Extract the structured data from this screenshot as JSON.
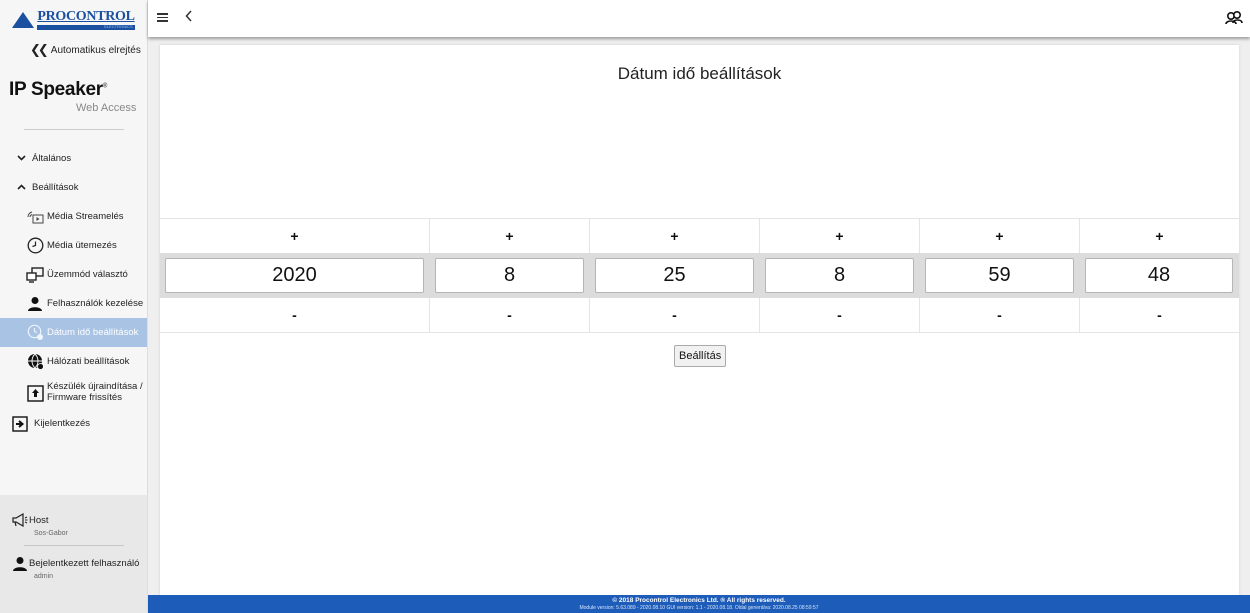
{
  "logo": {
    "brand": "PROCONTROL",
    "sub": "ELECTRONICS"
  },
  "sidebar": {
    "collapse_label": "Automatikus elrejtés",
    "product": {
      "name": "IP Speaker",
      "reg": "®",
      "sub": "Web Access"
    },
    "groups": [
      {
        "label": "Általános",
        "expanded": false
      },
      {
        "label": "Beállítások",
        "expanded": true
      }
    ],
    "items": [
      {
        "label": "Média Streamelés",
        "icon": "media-stream-icon"
      },
      {
        "label": "Média ütemezés",
        "icon": "clock-icon"
      },
      {
        "label": "Üzemmód választó",
        "icon": "mode-select-icon"
      },
      {
        "label": "Felhasználók kezelése",
        "icon": "user-icon"
      },
      {
        "label": "Dátum idő beállítások",
        "icon": "datetime-icon",
        "active": true
      },
      {
        "label": "Hálózati beállítások",
        "icon": "network-icon"
      },
      {
        "label_line1": "Készülék újraindítása /",
        "label_line2": "Firmware frissítés",
        "icon": "upload-icon"
      }
    ],
    "logout": "Kijelentkezés",
    "host": {
      "title": "Host",
      "value": "Sos-Gabor"
    },
    "user": {
      "title": "Bejelentkezett felhasználó",
      "value": "admin"
    }
  },
  "topbar": {
    "menu_icon": "hamburger-icon",
    "back_icon": "chevron-left-icon",
    "right_icon": "users-icon"
  },
  "main": {
    "title": "Dátum idő beállítások",
    "plus_label": "+",
    "minus_label": "-",
    "fields": [
      {
        "name": "year",
        "value": "2020"
      },
      {
        "name": "month",
        "value": "8"
      },
      {
        "name": "day",
        "value": "25"
      },
      {
        "name": "hour",
        "value": "8"
      },
      {
        "name": "minute",
        "value": "59"
      },
      {
        "name": "second",
        "value": "48"
      }
    ],
    "submit_label": "Beállítás"
  },
  "footer": {
    "line1": "© 2018 Procontrol Electronics Ltd. ® All rights reserved.",
    "line2": "Module version: 5.63.089 - 2020.08.10    GUI version: 1.1 - 2020.08.18.    Oldal generálva: 2020.08.25 08:59:57"
  },
  "colors": {
    "accent": "#1d5cb8",
    "active_item": "#a9c3e4",
    "brand": "#1b4fa0"
  }
}
